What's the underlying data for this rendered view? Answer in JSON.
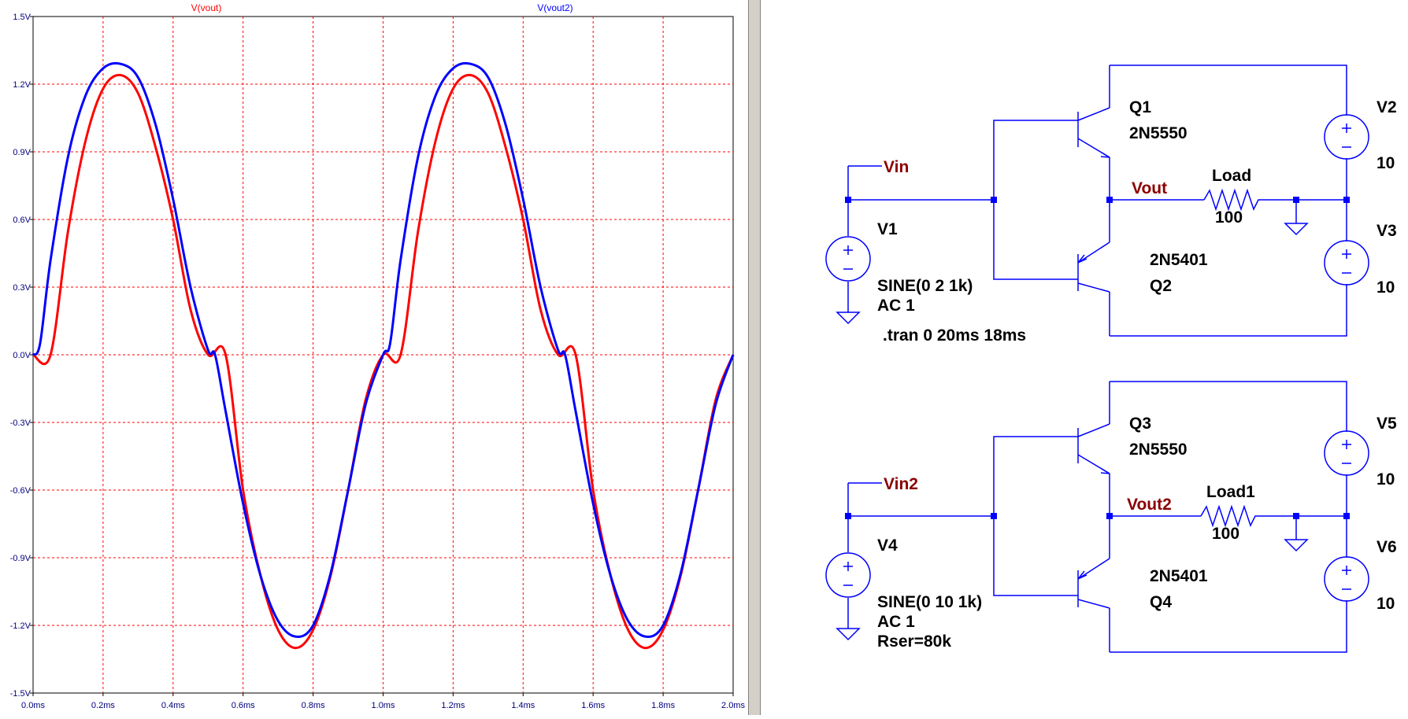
{
  "window": {
    "panes": [
      "waveform-plot",
      "schematic"
    ]
  },
  "waveform": {
    "chart_data": {
      "type": "line",
      "title": "",
      "xlabel": "",
      "ylabel": "",
      "xlim": [
        0,
        2.0
      ],
      "ylim": [
        -1.5,
        1.5
      ],
      "grid": true,
      "legend": "top",
      "x_ticks": [
        "0.0ms",
        "0.2ms",
        "0.4ms",
        "0.6ms",
        "0.8ms",
        "1.0ms",
        "1.2ms",
        "1.4ms",
        "1.6ms",
        "1.8ms",
        "2.0ms"
      ],
      "y_ticks": [
        "1.5V",
        "1.2V",
        "0.9V",
        "0.6V",
        "0.3V",
        "0.0V",
        "-0.3V",
        "-0.6V",
        "-0.9V",
        "-1.2V",
        "-1.5V"
      ],
      "series": [
        {
          "name": "V(vout)",
          "color": "#ff0000",
          "x": [
            0,
            0.05,
            0.1,
            0.15,
            0.2,
            0.25,
            0.3,
            0.35,
            0.4,
            0.45,
            0.5,
            0.55,
            0.6,
            0.65,
            0.7,
            0.75,
            0.8,
            0.85,
            0.9,
            0.95,
            1.0,
            1.05,
            1.1,
            1.15,
            1.2,
            1.25,
            1.3,
            1.35,
            1.4,
            1.45,
            1.5,
            1.55,
            1.6,
            1.65,
            1.7,
            1.75,
            1.8,
            1.85,
            1.9,
            1.95,
            2.0
          ],
          "values": [
            0,
            0,
            0.55,
            0.95,
            1.18,
            1.24,
            1.16,
            0.92,
            0.6,
            0.2,
            0,
            0,
            -0.6,
            -0.98,
            -1.22,
            -1.3,
            -1.22,
            -0.98,
            -0.6,
            -0.2,
            0,
            0,
            0.55,
            0.95,
            1.18,
            1.24,
            1.16,
            0.92,
            0.6,
            0.2,
            0,
            0,
            -0.6,
            -0.98,
            -1.22,
            -1.3,
            -1.22,
            -0.98,
            -0.6,
            -0.2,
            0
          ]
        },
        {
          "name": "V(vout2)",
          "color": "#0000ff",
          "x": [
            0,
            0.02,
            0.05,
            0.1,
            0.15,
            0.2,
            0.25,
            0.3,
            0.35,
            0.4,
            0.45,
            0.5,
            0.52,
            0.55,
            0.6,
            0.65,
            0.7,
            0.75,
            0.8,
            0.85,
            0.9,
            0.95,
            1.0,
            1.02,
            1.05,
            1.1,
            1.15,
            1.2,
            1.25,
            1.3,
            1.35,
            1.4,
            1.45,
            1.5,
            1.52,
            1.55,
            1.6,
            1.65,
            1.7,
            1.75,
            1.8,
            1.85,
            1.9,
            1.95,
            2.0
          ],
          "values": [
            0,
            0.05,
            0.42,
            0.88,
            1.15,
            1.27,
            1.29,
            1.23,
            1.02,
            0.69,
            0.3,
            0.02,
            0,
            -0.25,
            -0.66,
            -0.98,
            -1.18,
            -1.25,
            -1.2,
            -0.97,
            -0.6,
            -0.22,
            0,
            0.05,
            0.42,
            0.88,
            1.15,
            1.27,
            1.29,
            1.23,
            1.02,
            0.69,
            0.3,
            0.02,
            0,
            -0.25,
            -0.66,
            -0.98,
            -1.18,
            -1.25,
            -1.2,
            -0.97,
            -0.6,
            -0.22,
            0
          ]
        }
      ]
    }
  },
  "schematic": {
    "nets": {
      "vin": "Vin",
      "vout": "Vout",
      "vin2": "Vin2",
      "vout2": "Vout2"
    },
    "components": {
      "q1": "Q1",
      "q1_model": "2N5550",
      "q2": "Q2",
      "q2_model": "2N5401",
      "q3": "Q3",
      "q3_model": "2N5550",
      "q4": "Q4",
      "q4_model": "2N5401",
      "load": "Load",
      "load_value": "100",
      "load1": "Load1",
      "load1_value": "100",
      "v1": "V1",
      "v1_func": "SINE(0 2 1k)",
      "v1_ac": "AC 1",
      "v2": "V2",
      "v2_value": "10",
      "v3": "V3",
      "v3_value": "10",
      "v4": "V4",
      "v4_func": "SINE(0 10 1k)",
      "v4_ac": "AC 1",
      "v4_rser": "Rser=80k",
      "v5": "V5",
      "v5_value": "10",
      "v6": "V6",
      "v6_value": "10"
    },
    "directive": ".tran 0 20ms 18ms"
  }
}
